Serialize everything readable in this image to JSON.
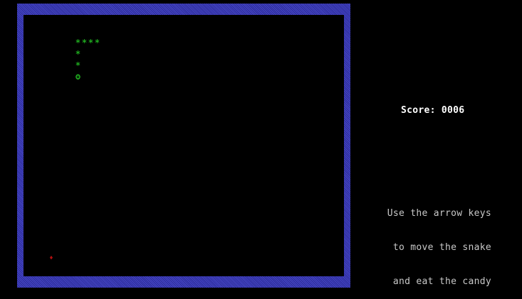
{
  "snake": {
    "body_glyph": "*",
    "head_glyph": "ʘ",
    "color": "#1faa1f"
  },
  "candy": {
    "glyph": "♦",
    "color": "#b01010"
  },
  "board": {
    "border_color": "#3c3cb4",
    "background": "#000000"
  },
  "score": {
    "label": "Score:",
    "value": "0006"
  },
  "instructions": {
    "lines": [
      "Use the arrow keys",
      "to move the snake",
      "and eat the candy"
    ]
  }
}
